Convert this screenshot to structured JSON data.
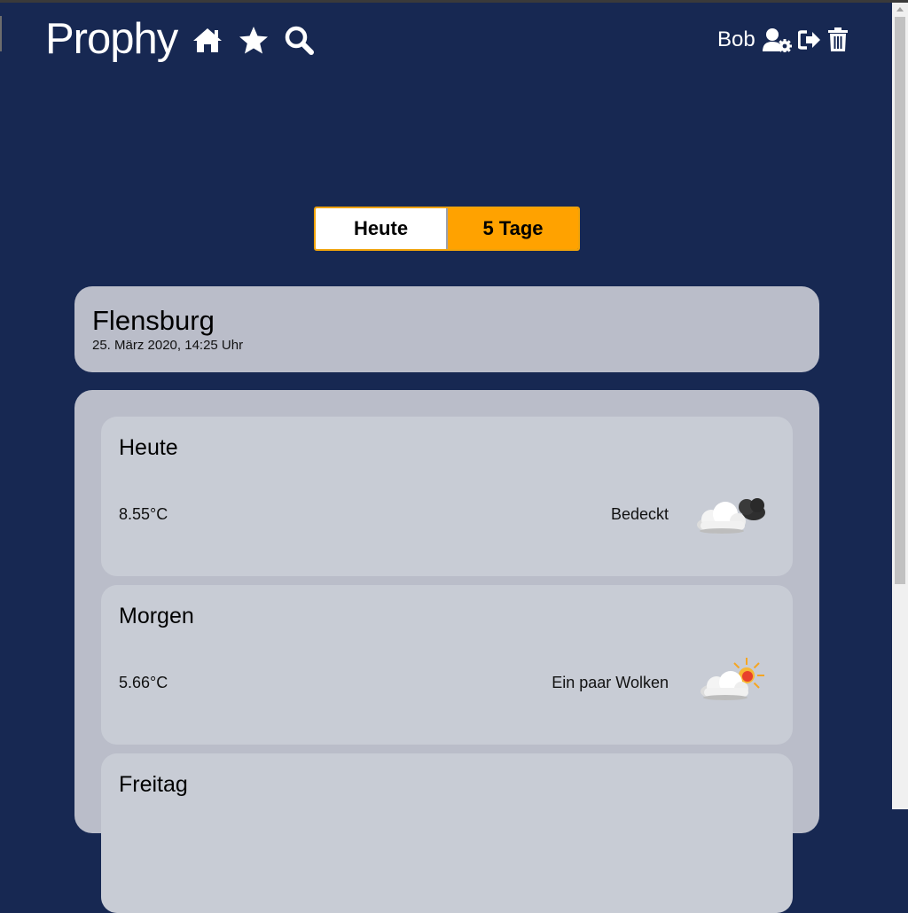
{
  "header": {
    "brand": "Prophy",
    "username": "Bob"
  },
  "toggle": {
    "today": "Heute",
    "five_days": "5 Tage"
  },
  "city": {
    "name": "Flensburg",
    "datetime": "25. März 2020, 14:25 Uhr"
  },
  "forecast": [
    {
      "day": "Heute",
      "temp": "8.55°C",
      "desc": "Bedeckt",
      "icon": "overcast-clouds-icon"
    },
    {
      "day": "Morgen",
      "temp": "5.66°C",
      "desc": "Ein paar Wolken",
      "icon": "few-clouds-icon"
    },
    {
      "day": "Freitag"
    }
  ],
  "colors": {
    "background": "#172852",
    "accent": "#ffa200",
    "card": "#babdc9",
    "day_card": "#c8ccd5"
  },
  "icons": [
    "home-icon",
    "star-icon",
    "search-icon",
    "user-settings-icon",
    "logout-icon",
    "trash-icon"
  ]
}
